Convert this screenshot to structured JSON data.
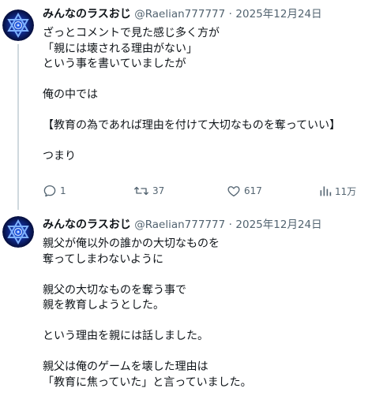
{
  "tweets": [
    {
      "author": {
        "name": "みんなのラスおじ",
        "handle": "@Raelian777777",
        "separator": "·",
        "date": "2025年12月24日",
        "avatar_icon": "star-of-david-avatar-icon"
      },
      "lines": [
        "ざっとコメントで見た感じ多く方が",
        "「親には壊される理由がない」",
        "という事を書いていましたが",
        "",
        "俺の中では",
        "",
        "【教育の為であれば理由を付けて大切なものを奪っていい】",
        "",
        "つまり"
      ],
      "actions": {
        "replies": "1",
        "retweets": "37",
        "likes": "617",
        "views": "11万"
      }
    },
    {
      "author": {
        "name": "みんなのラスおじ",
        "handle": "@Raelian777777",
        "separator": "·",
        "date": "2025年12月24日",
        "avatar_icon": "star-of-david-avatar-icon"
      },
      "lines": [
        "親父が俺以外の誰かの大切なものを",
        "奪ってしまわないように",
        "",
        "親父の大切なものを奪う事で",
        "親を教育しようとした。",
        "",
        "という理由を親には話しました。",
        "",
        "親父は俺のゲームを壊した理由は",
        "「教育に焦っていた」と言っていました。"
      ]
    }
  ],
  "colors": {
    "text_primary": "#0f1419",
    "text_secondary": "#536471",
    "thread_line": "#cfd9de",
    "avatar_bg": "#0a1a5c",
    "avatar_glow": "#2b6cff"
  }
}
